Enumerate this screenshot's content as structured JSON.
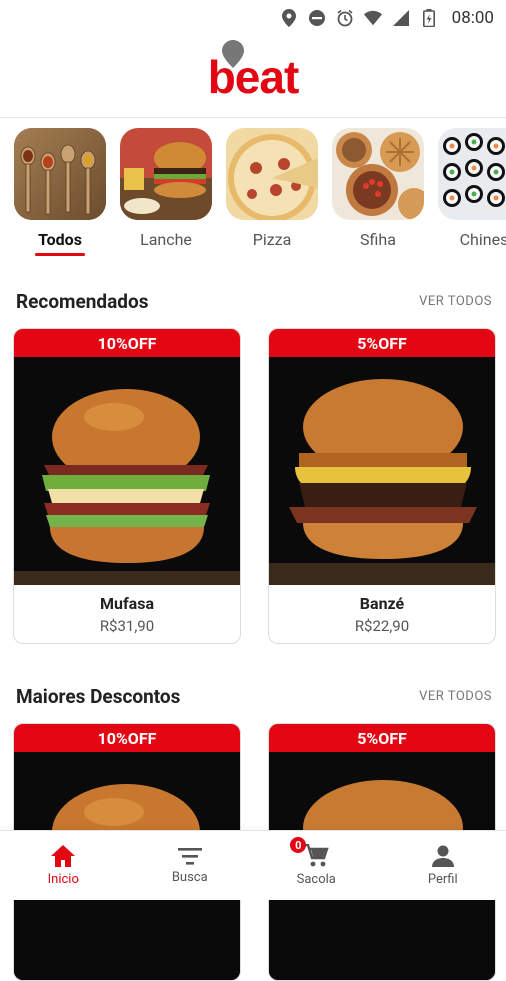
{
  "status": {
    "time": "08:00"
  },
  "brand": {
    "name": "beat"
  },
  "categories": [
    {
      "label": "Todos",
      "active": true
    },
    {
      "label": "Lanche"
    },
    {
      "label": "Pizza"
    },
    {
      "label": "Sfiha"
    },
    {
      "label": "Chines"
    }
  ],
  "recommended": {
    "title": "Recomendados",
    "see_all": "VER TODOS",
    "items": [
      {
        "badge": "10%OFF",
        "name": "Mufasa",
        "price": "R$31,90"
      },
      {
        "badge": "5%OFF",
        "name": "Banzé",
        "price": "R$22,90"
      }
    ]
  },
  "discounts": {
    "title": "Maiores Descontos",
    "see_all": "VER TODOS",
    "items": [
      {
        "badge": "10%OFF"
      },
      {
        "badge": "5%OFF"
      }
    ]
  },
  "nav": {
    "items": [
      {
        "label": "Inicio",
        "icon": "home-icon",
        "active": true
      },
      {
        "label": "Busca",
        "icon": "filter-icon"
      },
      {
        "label": "Sacola",
        "icon": "cart-icon",
        "badge": "0"
      },
      {
        "label": "Perfil",
        "icon": "person-icon"
      }
    ]
  },
  "colors": {
    "accent": "#e30613"
  }
}
